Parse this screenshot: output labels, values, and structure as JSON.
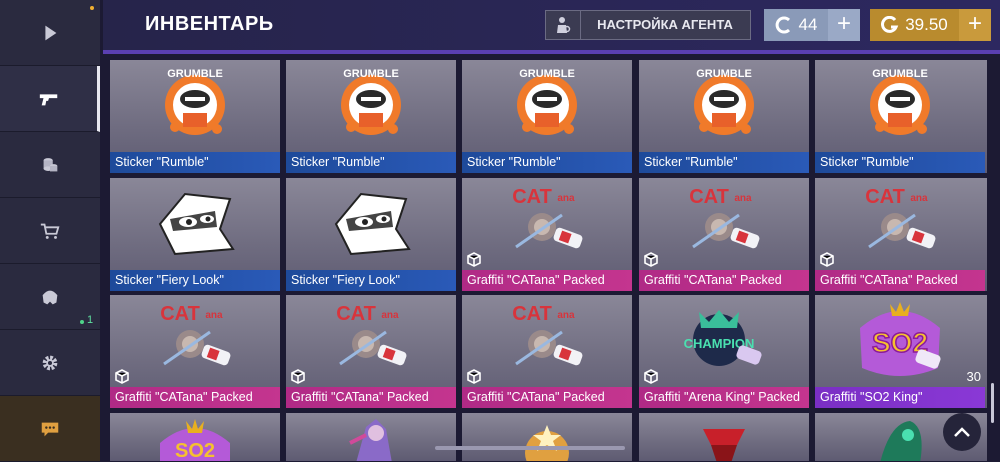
{
  "header": {
    "title": "ИНВЕНТАРЬ",
    "agent_button": "НАСТРОЙКА АГЕНТА",
    "silver_balance": "44",
    "gold_balance": "39.50"
  },
  "sidebar": {
    "items": [
      {
        "icon": "play-icon"
      },
      {
        "icon": "pistol-icon"
      },
      {
        "icon": "coins-icon"
      },
      {
        "icon": "cart-icon"
      },
      {
        "icon": "clan-icon",
        "badge": "1"
      },
      {
        "icon": "gear-icon"
      },
      {
        "icon": "chat-icon"
      }
    ]
  },
  "grid": {
    "rows": [
      [
        {
          "name": "Sticker \"Rumble\"",
          "type": "rumble",
          "color": "blue"
        },
        {
          "name": "Sticker \"Rumble\"",
          "type": "rumble",
          "color": "blue"
        },
        {
          "name": "Sticker \"Rumble\"",
          "type": "rumble",
          "color": "blue"
        },
        {
          "name": "Sticker \"Rumble\"",
          "type": "rumble",
          "color": "blue"
        },
        {
          "name": "Sticker \"Rumble\"",
          "type": "rumble",
          "color": "blue"
        }
      ],
      [
        {
          "name": "Sticker \"Fiery Look\"",
          "type": "fiery",
          "color": "blue"
        },
        {
          "name": "Sticker \"Fiery Look\"",
          "type": "fiery",
          "color": "blue"
        },
        {
          "name": "Graffiti \"CATana\" Packed",
          "type": "catana",
          "color": "pink",
          "packed": true
        },
        {
          "name": "Graffiti \"CATana\" Packed",
          "type": "catana",
          "color": "pink",
          "packed": true
        },
        {
          "name": "Graffiti \"CATana\" Packed",
          "type": "catana",
          "color": "pink",
          "packed": true
        }
      ],
      [
        {
          "name": "Graffiti \"CATana\" Packed",
          "type": "catana",
          "color": "pink",
          "packed": true
        },
        {
          "name": "Graffiti \"CATana\" Packed",
          "type": "catana",
          "color": "pink",
          "packed": true
        },
        {
          "name": "Graffiti \"CATana\" Packed",
          "type": "catana",
          "color": "pink",
          "packed": true
        },
        {
          "name": "Graffiti \"Arena King\" Packed",
          "type": "arena",
          "color": "pink",
          "packed": true
        },
        {
          "name": "Graffiti \"SO2 King\"",
          "type": "so2",
          "color": "purple",
          "count": "30"
        }
      ]
    ]
  },
  "colors": {
    "accent": "#5a3fb0",
    "gold": "#b98b2e",
    "silver": "#8a9ab8"
  }
}
